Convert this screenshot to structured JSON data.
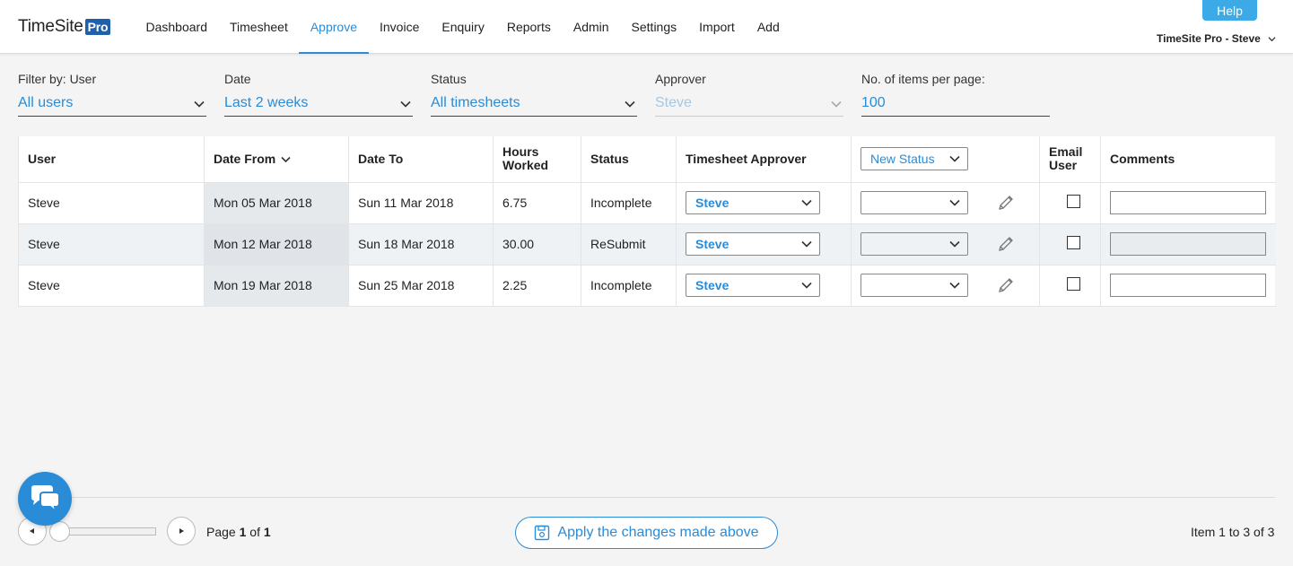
{
  "header": {
    "logo_text": "TimeSite",
    "logo_badge": "Pro",
    "nav": [
      "Dashboard",
      "Timesheet",
      "Approve",
      "Invoice",
      "Enquiry",
      "Reports",
      "Admin",
      "Settings",
      "Import",
      "Add"
    ],
    "active_nav": "Approve",
    "help_label": "Help",
    "user_label": "TimeSite Pro - Steve"
  },
  "filters": {
    "user": {
      "label": "Filter by: User",
      "value": "All users"
    },
    "date": {
      "label": "Date",
      "value": "Last 2 weeks"
    },
    "status": {
      "label": "Status",
      "value": "All timesheets"
    },
    "approver": {
      "label": "Approver",
      "value": "Steve"
    },
    "per_page": {
      "label": "No. of items per page:",
      "value": "100"
    }
  },
  "table": {
    "headers": {
      "user": "User",
      "date_from": "Date From",
      "date_to": "Date To",
      "hours_line1": "Hours",
      "hours_line2": "Worked",
      "status": "Status",
      "approver": "Timesheet Approver",
      "new_status": "New Status",
      "email_line1": "Email",
      "email_line2": "User",
      "comments": "Comments"
    },
    "rows": [
      {
        "user": "Steve",
        "date_from": "Mon 05 Mar 2018",
        "date_to": "Sun 11 Mar 2018",
        "hours": "6.75",
        "status": "Incomplete",
        "approver": "Steve"
      },
      {
        "user": "Steve",
        "date_from": "Mon 12 Mar 2018",
        "date_to": "Sun 18 Mar 2018",
        "hours": "30.00",
        "status": "ReSubmit",
        "approver": "Steve"
      },
      {
        "user": "Steve",
        "date_from": "Mon 19 Mar 2018",
        "date_to": "Sun 25 Mar 2018",
        "hours": "2.25",
        "status": "Incomplete",
        "approver": "Steve"
      }
    ]
  },
  "footer": {
    "page_prefix": "Page ",
    "page_current": "1",
    "page_of": " of ",
    "page_total": "1",
    "apply_label": "Apply the changes made above",
    "item_count": "Item 1 to 3 of 3"
  },
  "colors": {
    "accent": "#2a8bd6",
    "help": "#3daae8",
    "logo_badge": "#1f5fae"
  }
}
